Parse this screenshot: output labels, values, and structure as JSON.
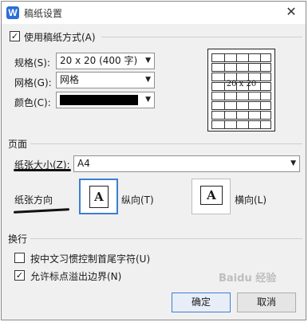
{
  "window": {
    "title": "稿纸设置",
    "app_icon": "W"
  },
  "use_manuscript": {
    "label": "使用稿纸方式(A)",
    "checked": true
  },
  "spec": {
    "label": "规格(S):",
    "value": "20 x 20 (400 字)"
  },
  "grid": {
    "label": "网格(G):",
    "value": "网格"
  },
  "color": {
    "label": "颜色(C):",
    "value": "#000000"
  },
  "preview": {
    "label": "20 x 20"
  },
  "page_section": {
    "title": "页面",
    "paper_size_label": "纸张大小(Z):",
    "paper_size_value": "A4",
    "orientation_label": "纸张方向",
    "portrait_label": "纵向(T)",
    "landscape_label": "横向(L)",
    "portrait_glyph": "A",
    "landscape_glyph": "A",
    "selected": "portrait"
  },
  "wrap_section": {
    "title": "换行",
    "opt1": {
      "label": "按中文习惯控制首尾字符(U)",
      "checked": false
    },
    "opt2": {
      "label": "允许标点溢出边界(N)",
      "checked": true
    }
  },
  "buttons": {
    "ok": "确定",
    "cancel": "取消"
  },
  "watermark": "Baidu 经验"
}
